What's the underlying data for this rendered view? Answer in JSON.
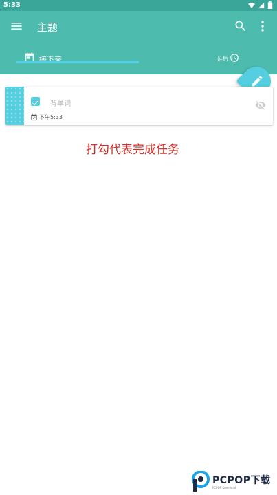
{
  "status_bar": {
    "time": "5:33"
  },
  "app_bar": {
    "title": "主题"
  },
  "tabs": [
    {
      "label": "接下来",
      "selected": true
    },
    {
      "label": "延后",
      "selected": false
    }
  ],
  "task": {
    "title": "背单词",
    "completed": true,
    "due_time": "下午5:33"
  },
  "annotation": "打勾代表完成任务",
  "watermark": {
    "brand": "PCPOP下载",
    "sub": "PCPOP Download"
  },
  "colors": {
    "primary": "#4dbbad",
    "status_bar": "#3aa69a",
    "accent": "#55cfe0",
    "annotation": "#d0332b"
  }
}
